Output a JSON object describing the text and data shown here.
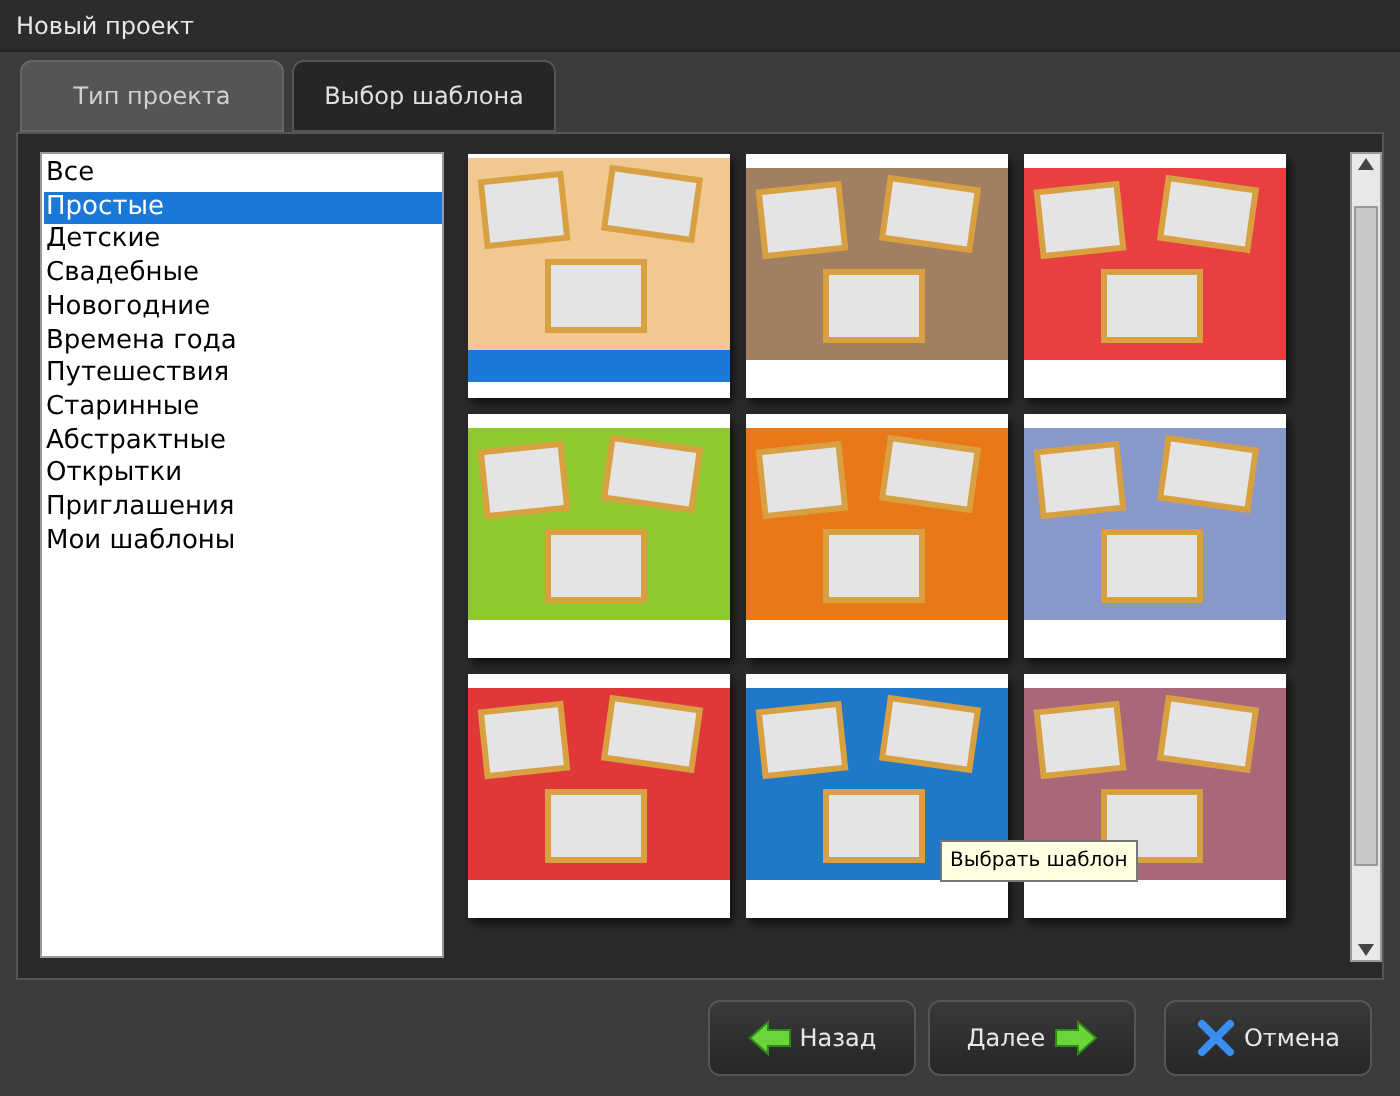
{
  "window": {
    "title": "Новый проект"
  },
  "tabs": [
    {
      "label": "Тип проекта",
      "selected": false
    },
    {
      "label": "Выбор шаблона",
      "selected": true
    }
  ],
  "categories": [
    {
      "label": "Все",
      "selected": false
    },
    {
      "label": "Простые",
      "selected": true
    },
    {
      "label": "Детские",
      "selected": false
    },
    {
      "label": "Свадебные",
      "selected": false
    },
    {
      "label": "Новогодние",
      "selected": false
    },
    {
      "label": "Времена года",
      "selected": false
    },
    {
      "label": "Путешествия",
      "selected": false
    },
    {
      "label": "Старинные",
      "selected": false
    },
    {
      "label": "Абстрактные",
      "selected": false
    },
    {
      "label": "Открытки",
      "selected": false
    },
    {
      "label": "Приглашения",
      "selected": false
    },
    {
      "label": "Мои шаблоны",
      "selected": false
    }
  ],
  "templates": [
    {
      "selected": true,
      "color": "#f0c890"
    },
    {
      "selected": false,
      "color": "#a08060"
    },
    {
      "selected": false,
      "color": "#e84040"
    },
    {
      "selected": false,
      "color": "#90c830"
    },
    {
      "selected": false,
      "color": "#e87818"
    },
    {
      "selected": false,
      "color": "#8898c8"
    },
    {
      "selected": false,
      "color": "#e03838"
    },
    {
      "selected": false,
      "color": "#2078c8"
    },
    {
      "selected": false,
      "color": "#a86878"
    }
  ],
  "tooltip": "Выбрать шаблон",
  "buttons": [
    {
      "kind": "back",
      "label": "Назад"
    },
    {
      "kind": "next",
      "label": "Далее"
    },
    {
      "kind": "cancel",
      "label": "Отмена"
    }
  ]
}
